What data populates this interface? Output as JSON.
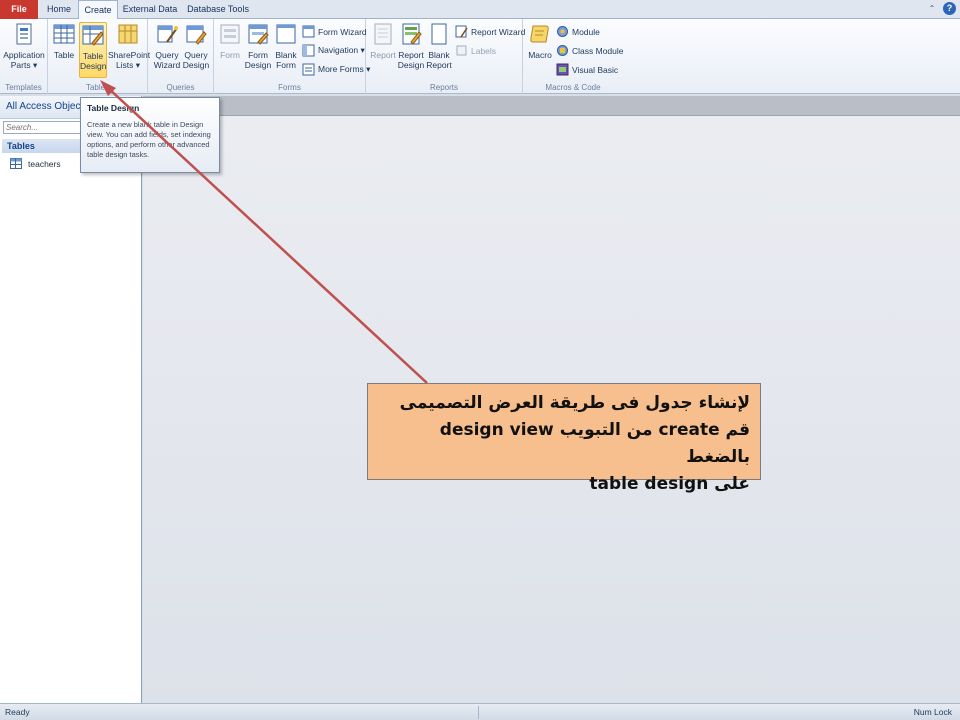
{
  "tabs": {
    "file": "File",
    "home": "Home",
    "create": "Create",
    "external_data": "External Data",
    "database_tools": "Database Tools"
  },
  "ribbon": {
    "templates": {
      "application_parts_line1": "Application",
      "application_parts_line2": "Parts ▾",
      "group_label": "Templates"
    },
    "tables": {
      "table": "Table",
      "table_design_line1": "Table",
      "table_design_line2": "Design",
      "sharepoint_lists_line1": "SharePoint",
      "sharepoint_lists_line2": "Lists ▾",
      "group_label": "Tables"
    },
    "queries": {
      "query_wizard_line1": "Query",
      "query_wizard_line2": "Wizard",
      "query_design_line1": "Query",
      "query_design_line2": "Design",
      "group_label": "Queries"
    },
    "forms": {
      "form": "Form",
      "form_design_line1": "Form",
      "form_design_line2": "Design",
      "blank_form_line1": "Blank",
      "blank_form_line2": "Form",
      "form_wizard": "Form Wizard",
      "navigation": "Navigation ▾",
      "more_forms": "More Forms ▾",
      "group_label": "Forms"
    },
    "reports": {
      "report": "Report",
      "report_design_line1": "Report",
      "report_design_line2": "Design",
      "blank_report_line1": "Blank",
      "blank_report_line2": "Report",
      "report_wizard": "Report Wizard",
      "labels": "Labels",
      "group_label": "Reports"
    },
    "macros": {
      "macro": "Macro",
      "module": "Module",
      "class_module": "Class Module",
      "visual_basic": "Visual Basic",
      "group_label": "Macros & Code"
    }
  },
  "nav_pane": {
    "header": "All Access Objects",
    "search_placeholder": "Search...",
    "section": "Tables",
    "items": [
      "teachers"
    ]
  },
  "tooltip": {
    "title": "Table Design",
    "body": "Create a new blank table in Design view. You can add fields, set indexing options, and perform other advanced table design tasks."
  },
  "annotation": {
    "line1": "لإنشاء جدول فى طريقة العرض التصميمى",
    "line2": "design view من التبويب create قم بالضغط",
    "line3": "على table design"
  },
  "status": {
    "left": "Ready",
    "right": "Num Lock"
  },
  "colors": {
    "file_tab": "#c8382e",
    "highlight": "#ffd966",
    "callout_fill": "#f8bf8e",
    "arrow": "#c0504d"
  }
}
